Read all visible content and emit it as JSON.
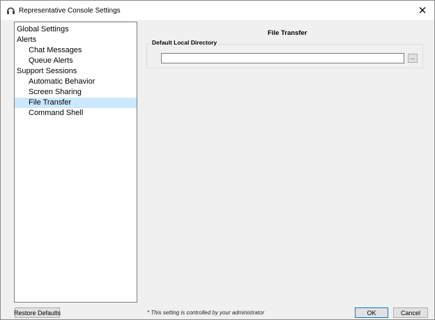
{
  "window": {
    "title": "Representative Console Settings",
    "app_icon": "headset-icon",
    "close_glyph": "✕"
  },
  "tree": {
    "items": [
      {
        "label": "Global Settings",
        "level": 0,
        "selected": false
      },
      {
        "label": "Alerts",
        "level": 0,
        "selected": false
      },
      {
        "label": "Chat Messages",
        "level": 1,
        "selected": false
      },
      {
        "label": "Queue Alerts",
        "level": 1,
        "selected": false
      },
      {
        "label": "Support Sessions",
        "level": 0,
        "selected": false
      },
      {
        "label": "Automatic Behavior",
        "level": 1,
        "selected": false
      },
      {
        "label": "Screen Sharing",
        "level": 1,
        "selected": false
      },
      {
        "label": "File Transfer",
        "level": 1,
        "selected": true
      },
      {
        "label": "Command Shell",
        "level": 1,
        "selected": false
      }
    ],
    "selection_color": "#cce8ff"
  },
  "panel": {
    "title": "File Transfer",
    "group_label": "Default Local Directory",
    "directory_value": "",
    "browse_label": "..."
  },
  "footer": {
    "restore_label": "Restore Defaults",
    "note": "* This setting is controlled by your administrator",
    "ok_label": "OK",
    "cancel_label": "Cancel"
  },
  "colors": {
    "accent": "#0078d7",
    "background": "#f0f0f0"
  }
}
